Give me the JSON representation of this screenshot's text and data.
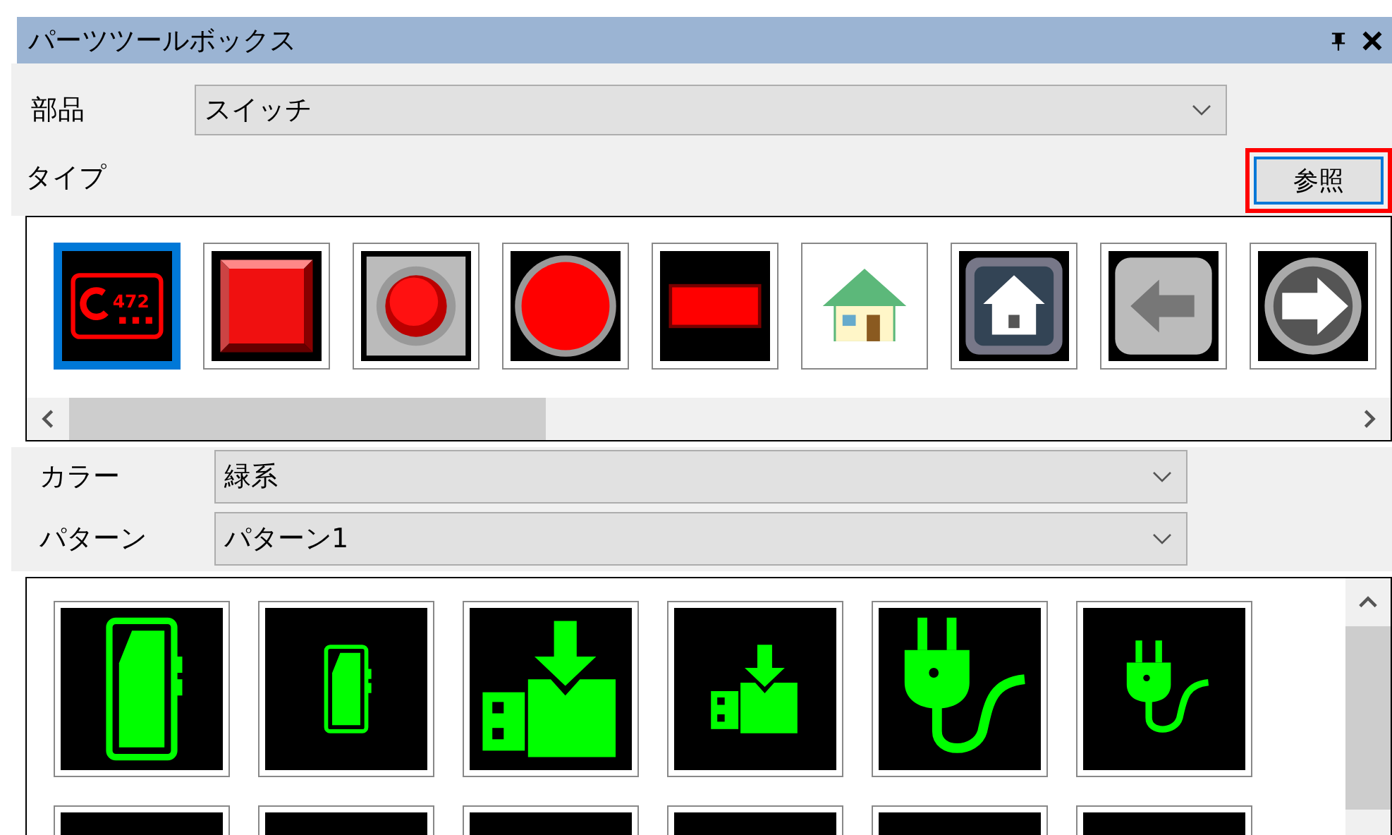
{
  "window": {
    "title": "パーツツールボックス",
    "buttons": [
      {
        "kind": "pin"
      },
      {
        "kind": "close"
      }
    ]
  },
  "part": {
    "label": "部品",
    "value": "スイッチ"
  },
  "type": {
    "label": "タイプ",
    "browse_button": {
      "label": "参照",
      "highlighted": true
    },
    "items": [
      {
        "kind": "seven-seg",
        "caption": "472",
        "selected": true
      },
      {
        "kind": "square",
        "selected": false
      },
      {
        "kind": "round-bezel",
        "selected": false
      },
      {
        "kind": "round",
        "selected": false
      },
      {
        "kind": "rect",
        "selected": false
      },
      {
        "kind": "house-color",
        "selected": false
      },
      {
        "kind": "house-dark",
        "selected": false
      },
      {
        "kind": "arrow-left",
        "selected": false
      },
      {
        "kind": "arrow-right",
        "selected": false
      }
    ]
  },
  "color": {
    "label": "カラー",
    "value": "緑系"
  },
  "pattern": {
    "label": "パターン",
    "value": "パターン1",
    "items": [
      {
        "kind": "phone-large",
        "selected": false
      },
      {
        "kind": "phone-small",
        "selected": false
      },
      {
        "kind": "usb-large",
        "selected": false
      },
      {
        "kind": "usb-small",
        "selected": false
      },
      {
        "kind": "plug-large",
        "selected": false
      },
      {
        "kind": "plug-small",
        "selected": false
      },
      {
        "kind": "cut",
        "selected": false
      },
      {
        "kind": "cut",
        "selected": false
      },
      {
        "kind": "cut",
        "selected": false
      },
      {
        "kind": "cut",
        "selected": false
      },
      {
        "kind": "cut",
        "selected": false
      },
      {
        "kind": "cut",
        "selected": false
      }
    ]
  }
}
